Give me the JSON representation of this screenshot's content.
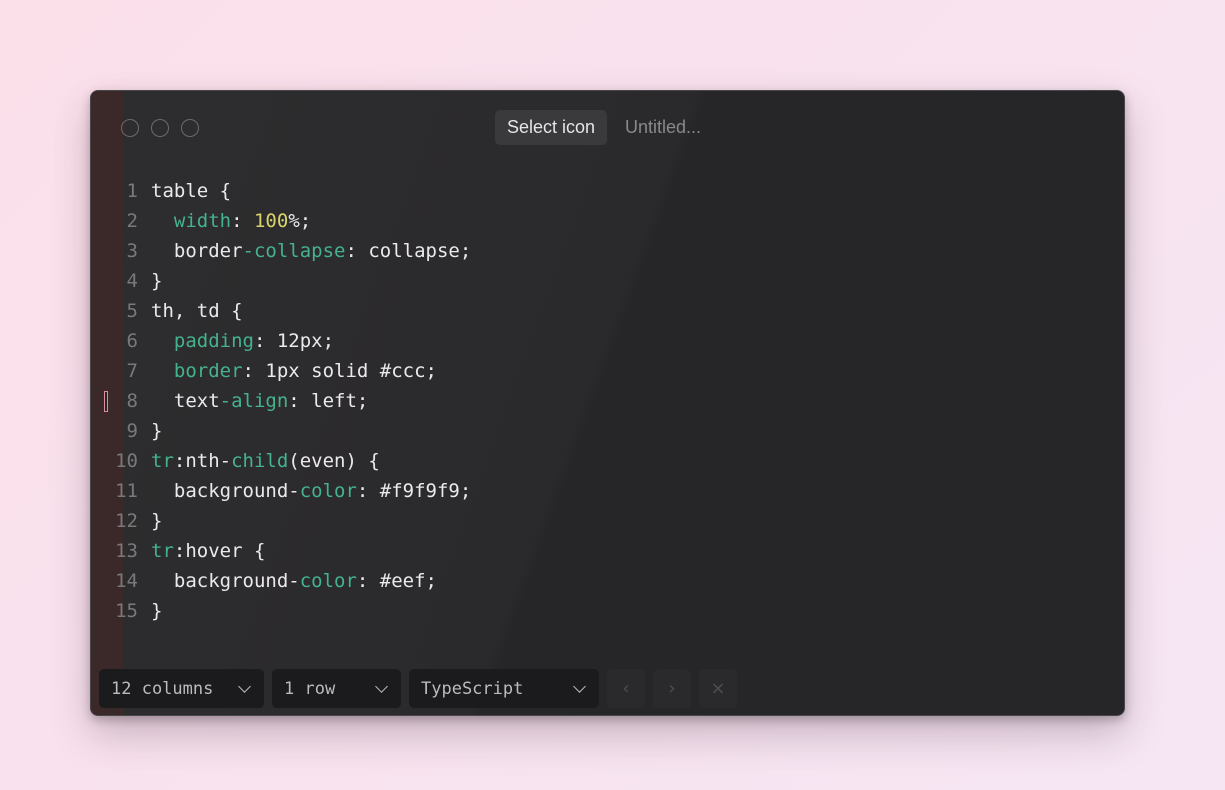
{
  "titlebar": {
    "select_icon_label": "Select icon",
    "title": "Untitled..."
  },
  "code": [
    {
      "n": "1",
      "parts": [
        {
          "t": "table {",
          "c": "plain"
        }
      ]
    },
    {
      "n": "2",
      "parts": [
        {
          "t": "  ",
          "c": "plain"
        },
        {
          "t": "width",
          "c": "prop"
        },
        {
          "t": ": ",
          "c": "plain"
        },
        {
          "t": "100",
          "c": "num"
        },
        {
          "t": "%;",
          "c": "plain"
        }
      ]
    },
    {
      "n": "3",
      "parts": [
        {
          "t": "  border",
          "c": "plain"
        },
        {
          "t": "-collapse",
          "c": "prop"
        },
        {
          "t": ": collapse;",
          "c": "plain"
        }
      ]
    },
    {
      "n": "4",
      "parts": [
        {
          "t": "}",
          "c": "plain"
        }
      ]
    },
    {
      "n": "5",
      "parts": [
        {
          "t": "th, td {",
          "c": "plain"
        }
      ]
    },
    {
      "n": "6",
      "parts": [
        {
          "t": "  ",
          "c": "plain"
        },
        {
          "t": "padding",
          "c": "prop"
        },
        {
          "t": ": 12px;",
          "c": "plain"
        }
      ]
    },
    {
      "n": "7",
      "parts": [
        {
          "t": "  ",
          "c": "plain"
        },
        {
          "t": "border",
          "c": "prop"
        },
        {
          "t": ": 1px solid #ccc;",
          "c": "plain"
        }
      ]
    },
    {
      "n": "8",
      "parts": [
        {
          "t": "  text",
          "c": "plain"
        },
        {
          "t": "-align",
          "c": "prop"
        },
        {
          "t": ": left;",
          "c": "plain"
        }
      ],
      "cursor": true
    },
    {
      "n": "9",
      "parts": [
        {
          "t": "}",
          "c": "plain"
        }
      ]
    },
    {
      "n": "10",
      "parts": [
        {
          "t": "tr",
          "c": "prop"
        },
        {
          "t": ":nth-",
          "c": "plain"
        },
        {
          "t": "child",
          "c": "prop"
        },
        {
          "t": "(even) {",
          "c": "plain"
        }
      ]
    },
    {
      "n": "11",
      "parts": [
        {
          "t": "  background-",
          "c": "plain"
        },
        {
          "t": "color",
          "c": "prop"
        },
        {
          "t": ": #f9f9f9;",
          "c": "plain"
        }
      ]
    },
    {
      "n": "12",
      "parts": [
        {
          "t": "}",
          "c": "plain"
        }
      ]
    },
    {
      "n": "13",
      "parts": [
        {
          "t": "tr",
          "c": "prop"
        },
        {
          "t": ":hover {",
          "c": "plain"
        }
      ]
    },
    {
      "n": "14",
      "parts": [
        {
          "t": "  background-",
          "c": "plain"
        },
        {
          "t": "color",
          "c": "prop"
        },
        {
          "t": ": #eef;",
          "c": "plain"
        }
      ]
    },
    {
      "n": "15",
      "parts": [
        {
          "t": "}",
          "c": "plain"
        }
      ]
    }
  ],
  "bottombar": {
    "columns_value": "12 columns",
    "rows_value": "1 row",
    "language_value": "TypeScript",
    "prev_glyph": "‹",
    "next_glyph": "›",
    "close_glyph": "×"
  },
  "colors": {
    "property": "#44b38d",
    "number": "#d8d46a",
    "text": "#ebe9ec"
  }
}
